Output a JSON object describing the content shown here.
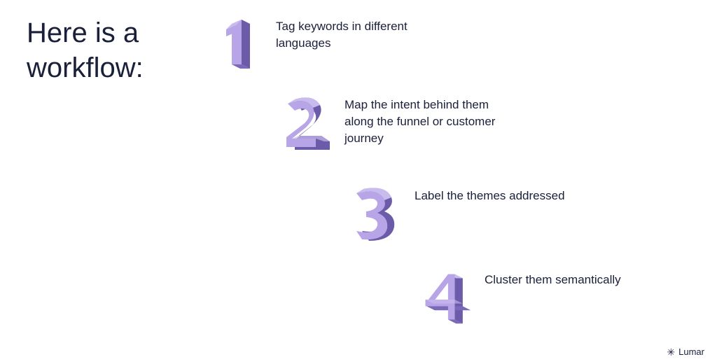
{
  "heading_line1": "Here is a",
  "heading_line2": "workflow:",
  "steps": [
    {
      "number": "1",
      "text": "Tag keywords in different languages"
    },
    {
      "number": "2",
      "text": "Map the intent behind them along the funnel or customer journey"
    },
    {
      "number": "3",
      "text": "Label the themes addressed"
    },
    {
      "number": "4",
      "text": "Cluster them semantically"
    }
  ],
  "footer": {
    "brand": "Lumar",
    "icon": "✳"
  },
  "colors": {
    "numeral_light": "#b8a5e8",
    "numeral_mid": "#9b84d9",
    "numeral_dark": "#6b5ba8",
    "text": "#1a1f3a"
  }
}
